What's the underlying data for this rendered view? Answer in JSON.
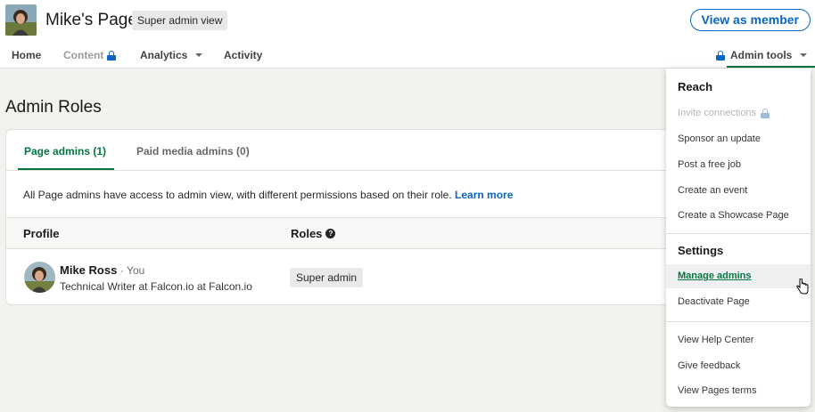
{
  "header": {
    "page_name": "Mike's Page",
    "view_badge": "Super admin view",
    "view_as_member": "View as member"
  },
  "nav": {
    "home": "Home",
    "content": "Content",
    "analytics": "Analytics",
    "activity": "Activity",
    "admin_tools": "Admin tools"
  },
  "main": {
    "title": "Admin Roles",
    "tabs": [
      {
        "label": "Page admins (1)",
        "active": true
      },
      {
        "label": "Paid media admins (0)",
        "active": false
      }
    ],
    "info_text": "All Page admins have access to admin view, with different permissions based on their role.",
    "learn_more": "Learn more",
    "columns": {
      "profile": "Profile",
      "roles": "Roles"
    },
    "admins": [
      {
        "name": "Mike Ross",
        "you": "· You",
        "headline": "Technical Writer at Falcon.io at Falcon.io",
        "role": "Super admin"
      }
    ]
  },
  "dropdown": {
    "reach_heading": "Reach",
    "reach_items": [
      "Invite connections",
      "Sponsor an update",
      "Post a free job",
      "Create an event",
      "Create a Showcase Page"
    ],
    "settings_heading": "Settings",
    "settings_items": [
      "Manage admins",
      "Deactivate Page"
    ],
    "help_items": [
      "View Help Center",
      "Give feedback",
      "View Pages terms"
    ]
  },
  "colors": {
    "accent_green": "#057642",
    "link_blue": "#0a66c2",
    "background": "#f3f2ef"
  }
}
